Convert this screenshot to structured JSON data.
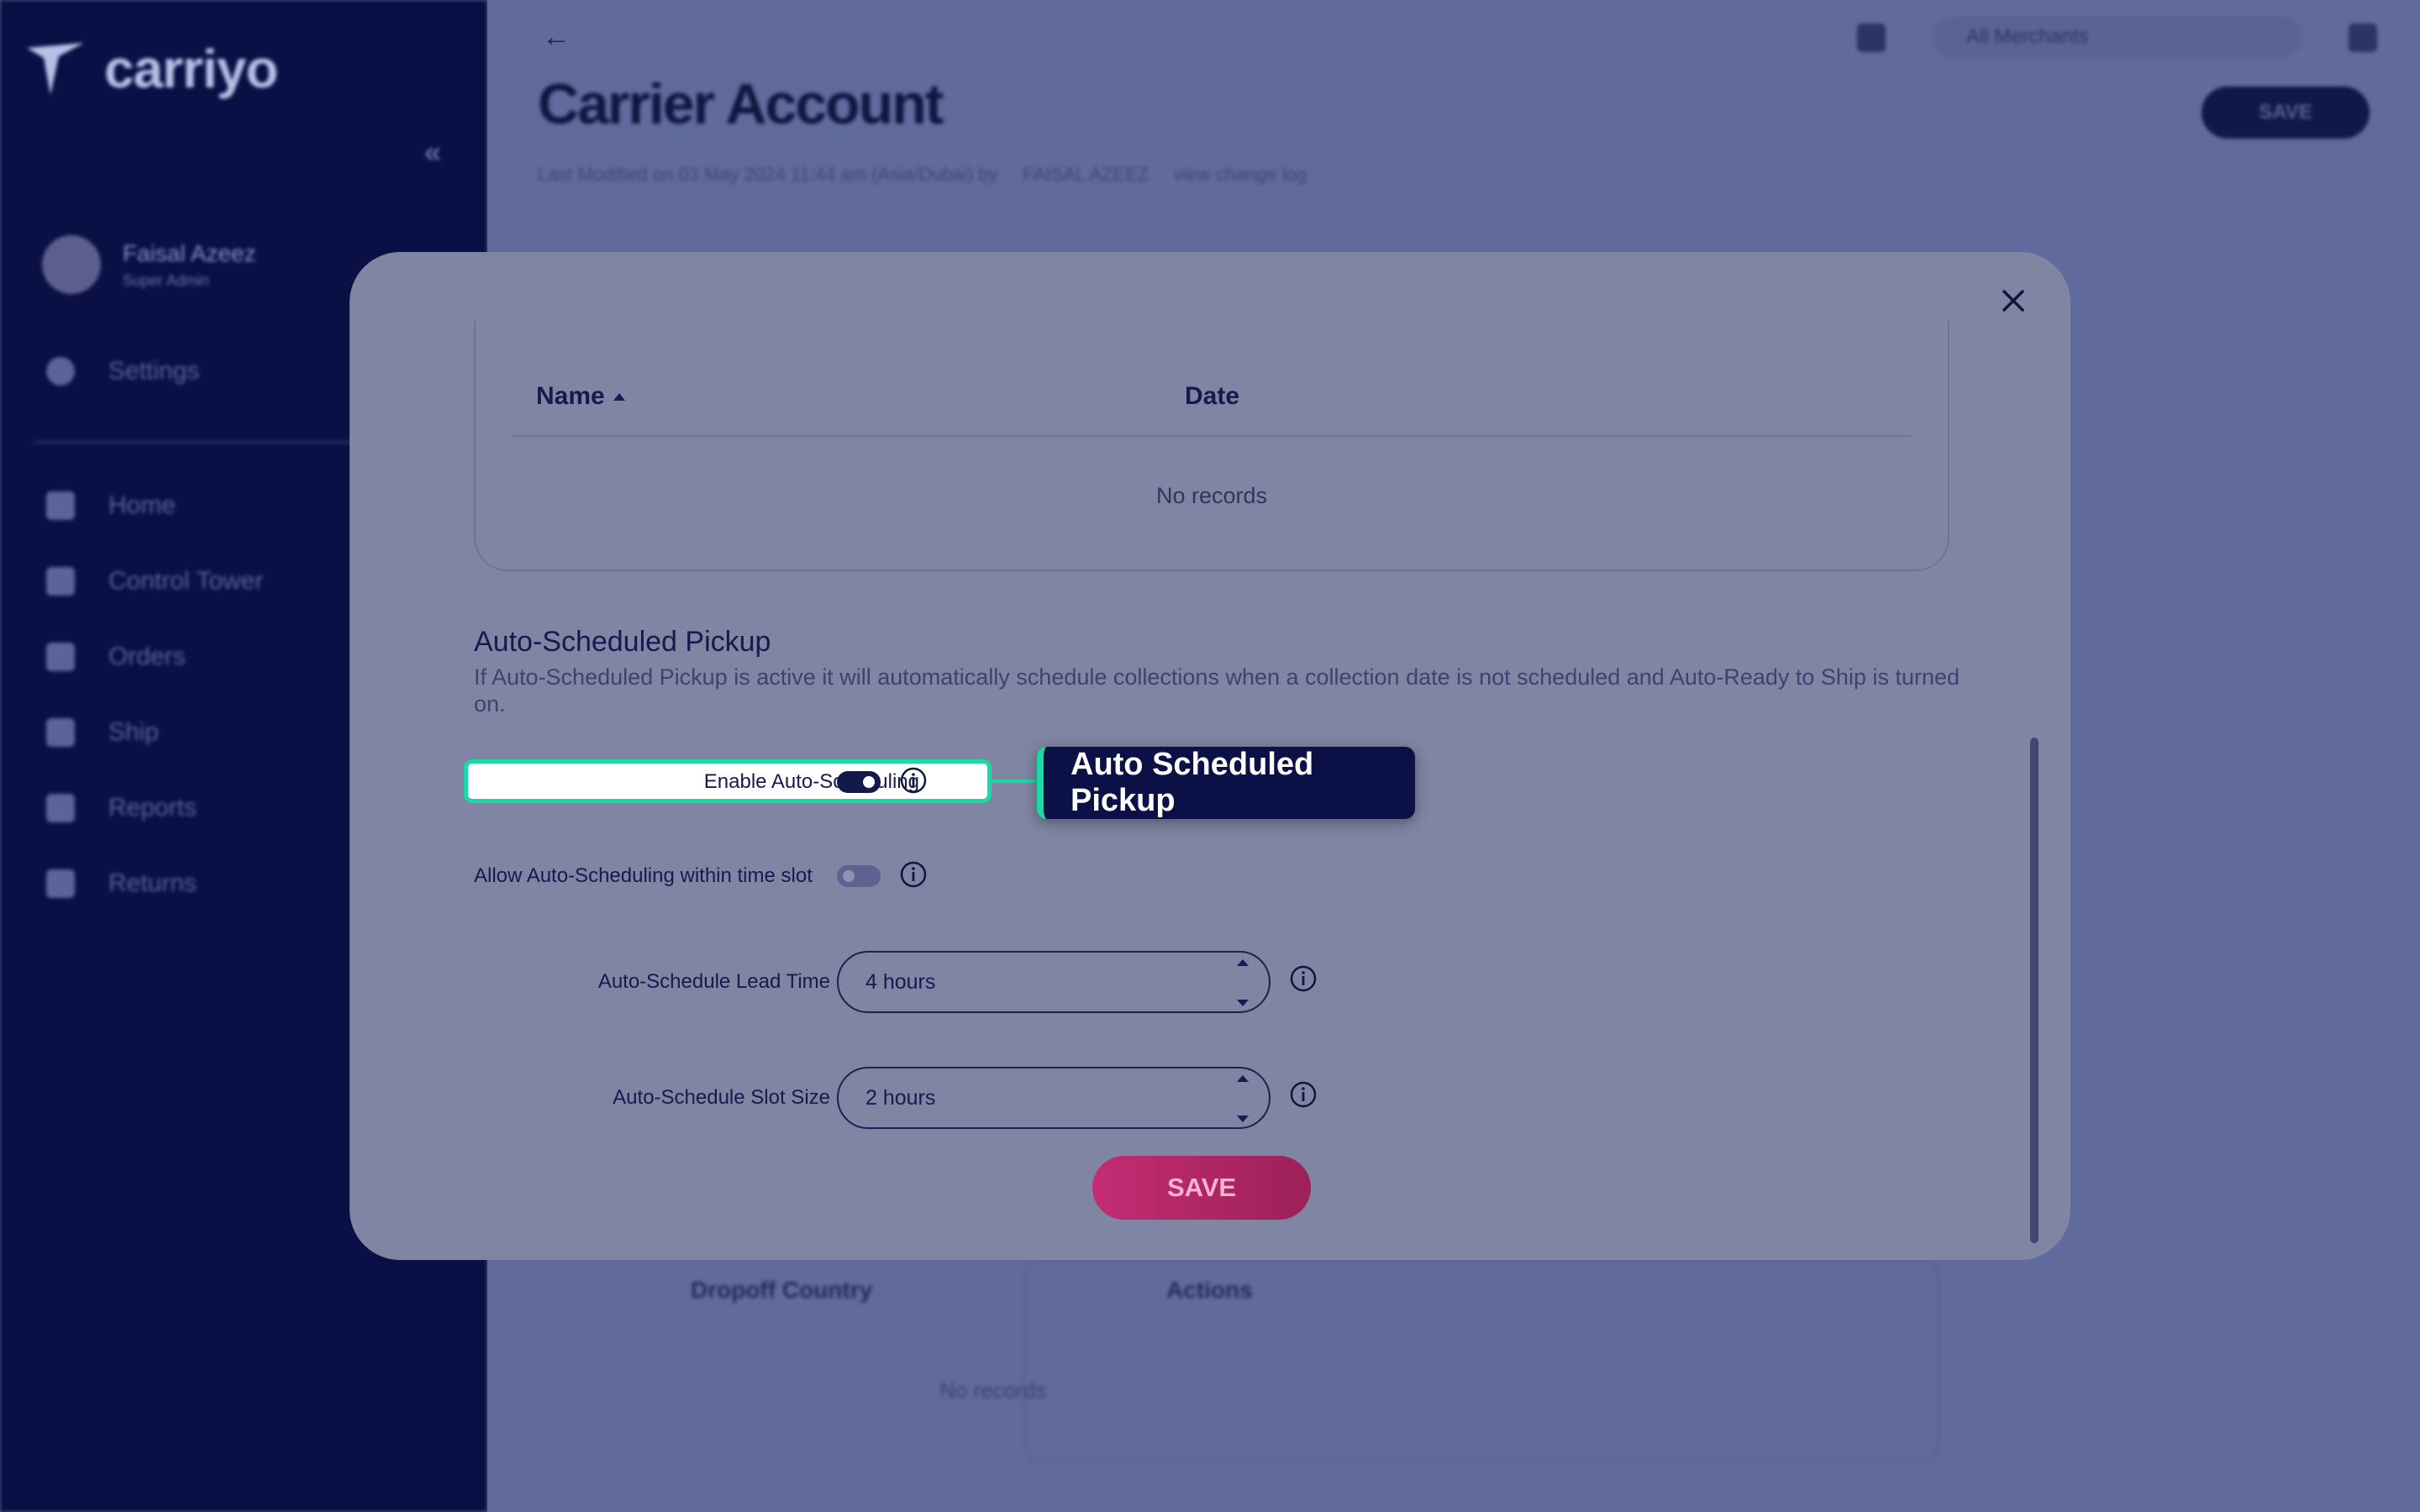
{
  "app": {
    "logo_text": "carriyo",
    "collapse_icon": "chevron-double-left-icon"
  },
  "user": {
    "name": "Faisal Azeez",
    "role": "Super Admin"
  },
  "sidebar": {
    "items": [
      {
        "label": "Settings",
        "icon": "gear-icon"
      },
      {
        "label": "Home",
        "icon": "home-icon"
      },
      {
        "label": "Control Tower",
        "icon": "grid-icon"
      },
      {
        "label": "Orders",
        "icon": "cart-icon"
      },
      {
        "label": "Ship",
        "icon": "box-icon"
      },
      {
        "label": "Reports",
        "icon": "chart-icon"
      },
      {
        "label": "Returns",
        "icon": "return-icon"
      }
    ]
  },
  "header": {
    "title": "Carrier Account",
    "meta": "Last Modified on 03 May 2024 11:44 am (Asia/Dubai) by",
    "modified_by": "FAISAL AZEEZ",
    "change_log": "view change log",
    "merchant_select": "All Merchants",
    "save_label": "SAVE"
  },
  "background_table": {
    "columns": [
      "Dropoff Country",
      "Actions"
    ],
    "empty_text": "No records"
  },
  "modal": {
    "table": {
      "columns": [
        "Name",
        "Date"
      ],
      "empty_text": "No records"
    },
    "section_title": "Auto-Scheduled Pickup",
    "section_description": "If Auto-Scheduled Pickup is active it will automatically schedule collections when a collection date is not scheduled and Auto-Ready to Ship is turned on.",
    "enable_auto_scheduling": {
      "label": "Enable Auto-Scheduling",
      "on": true
    },
    "allow_within_slot": {
      "label": "Allow Auto-Scheduling within time slot",
      "on": false
    },
    "lead_time": {
      "label": "Auto-Schedule Lead Time",
      "value": "4 hours"
    },
    "slot_size": {
      "label": "Auto-Schedule Slot Size",
      "value": "2 hours"
    },
    "save_label": "SAVE",
    "callout_text": "Auto Scheduled Pickup"
  },
  "colors": {
    "sidebar_bg": "#0a0f45",
    "accent_highlight": "#19d9a4",
    "save_button": "#c42c73",
    "callout_bg": "#0b1046"
  }
}
